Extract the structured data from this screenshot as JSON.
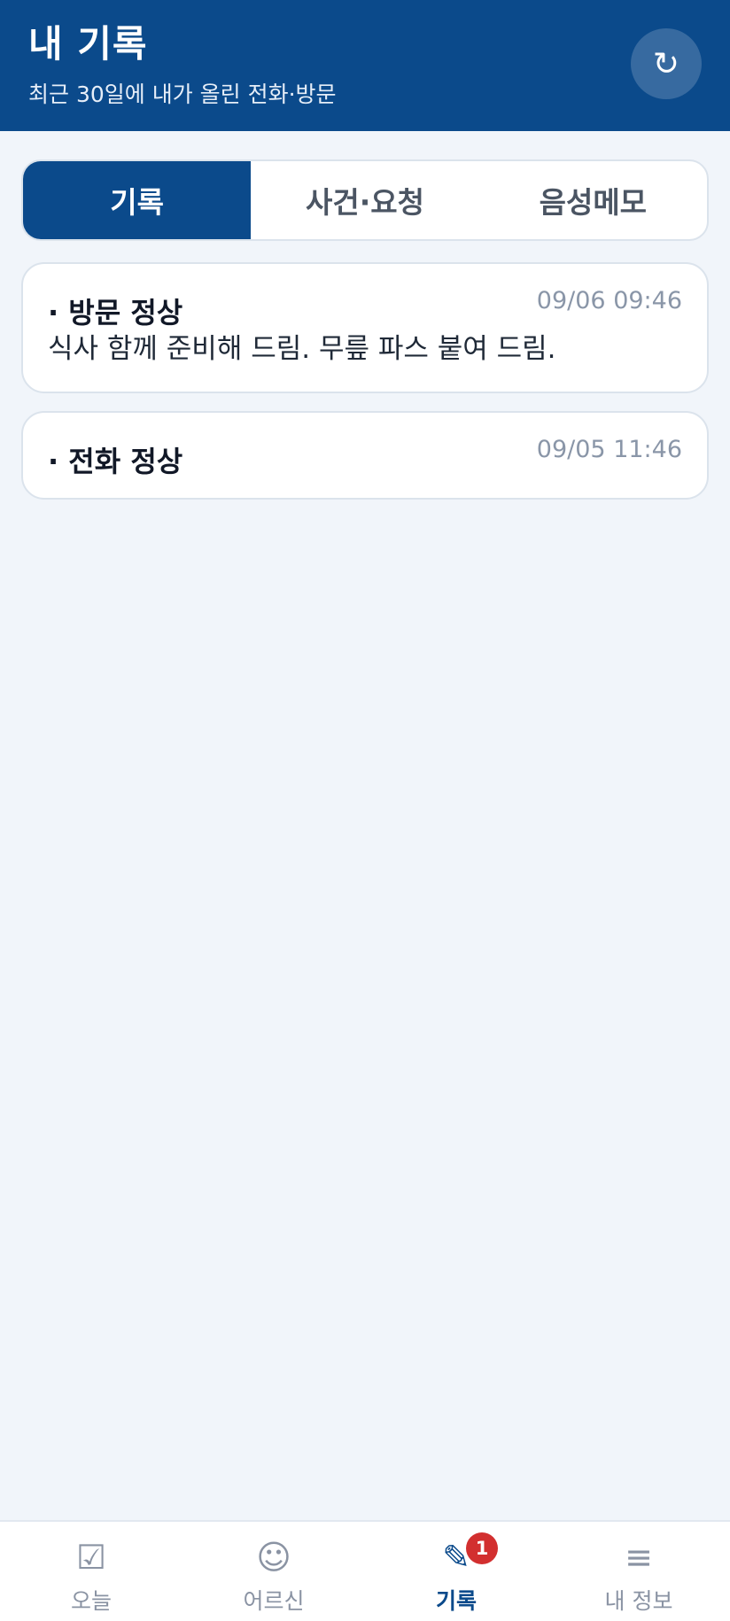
{
  "header": {
    "title": "내 기록",
    "subtitle": "최근 30일에 내가 올린 전화·방문",
    "refresh_icon": "↻"
  },
  "tabs": [
    {
      "label": "기록",
      "active": true
    },
    {
      "label": "사건·요청",
      "active": false
    },
    {
      "label": "음성메모",
      "active": false
    }
  ],
  "records": [
    {
      "title": "· 방문 정상",
      "time": "09/06 09:46",
      "note": "식사 함께 준비해 드림. 무릎 파스 붙여 드림."
    },
    {
      "title": "· 전화 정상",
      "time": "09/05 11:46",
      "note": ""
    }
  ],
  "bottom_nav": {
    "items": [
      {
        "icon": "☑",
        "label": "오늘"
      },
      {
        "icon": "☺",
        "label": "어르신"
      },
      {
        "icon": "✎",
        "label": "기록",
        "badge": "1"
      },
      {
        "icon": "≡",
        "label": "내 정보"
      }
    ]
  },
  "colors": {
    "primary": "#0b4a8b",
    "background": "#f1f5fa",
    "badge": "#d22f2f",
    "muted": "#8a96a8"
  }
}
